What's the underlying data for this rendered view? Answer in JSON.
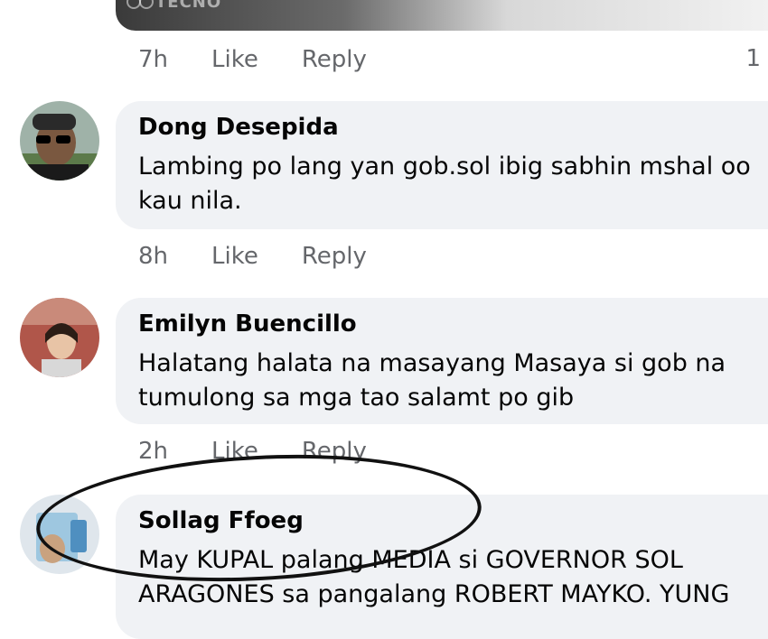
{
  "top_photo": {
    "watermark": "TECNO"
  },
  "comments": [
    {
      "time": "7h",
      "like": "Like",
      "reply": "Reply",
      "reactions": "1"
    },
    {
      "author": "Dong Desepida",
      "text": "Lambing po lang yan gob.sol ibig sabhin mshal oo kau nila.",
      "time": "8h",
      "like": "Like",
      "reply": "Reply"
    },
    {
      "author": "Emilyn Buencillo",
      "text": "Halatang halata na masayang Masaya si gob na tumulong sa mga tao salamt po gib",
      "time": "2h",
      "like": "Like",
      "reply": "Reply"
    },
    {
      "author": "Sollag Ffoeg",
      "text": "May KUPAL palang MEDIA si GOVERNOR SOL ARAGONES sa pangalang ROBERT MAYKO. YUNG"
    }
  ]
}
